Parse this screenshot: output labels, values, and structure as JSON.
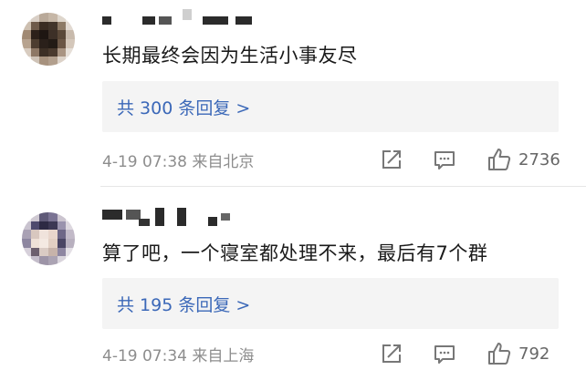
{
  "comments": [
    {
      "text": "长期最终会因为生活小事友尽",
      "reply_label": "共 300 条回复 >",
      "meta": "4-19 07:38  来自北京",
      "likes": "2736"
    },
    {
      "text": "算了吧，一个寝室都处理不来，最后有7个群",
      "reply_label": "共 195 条回复 >",
      "meta": "4-19 07:34  来自上海",
      "likes": "792"
    }
  ],
  "icons": {
    "share": "share-icon",
    "comment": "comment-icon",
    "like": "thumbs-up-icon"
  },
  "colors": {
    "link": "#3b68b8",
    "meta": "#8d8d8d",
    "reply_bg": "#f4f4f4"
  }
}
